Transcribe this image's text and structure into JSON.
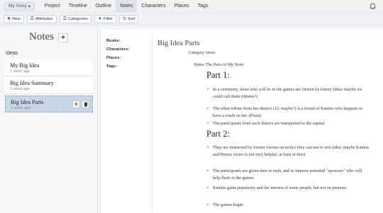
{
  "nav": {
    "story_label": "My Story",
    "links": [
      "Project",
      "Timeline",
      "Outline",
      "Notes",
      "Characters",
      "Places",
      "Tags"
    ],
    "active": "Notes"
  },
  "toolbar": {
    "new_label": "New",
    "attributes_label": "Attributes",
    "categories_label": "Categories",
    "filter_label": "Filter",
    "sort_label": "Sort"
  },
  "sidebar": {
    "title": "Notes",
    "add_label": "+",
    "group": "Ideas",
    "items": [
      {
        "title": "My Big Idea",
        "meta": "1 week ago"
      },
      {
        "title": "Big Idea Summary",
        "meta": "1 week ago"
      },
      {
        "title": "Big Idea Parts",
        "meta": "1 week ago"
      }
    ]
  },
  "main": {
    "props": [
      "Books:",
      "Characters:",
      "Places:",
      "Tags:"
    ],
    "title": "Big Idea Parts",
    "category_label": "Category",
    "category_value": "Ideas",
    "notes_label": "Notes",
    "notes_value": "The Parts of My Story",
    "part1_heading": "Part 1:",
    "part1": [
      "In a ceremony, those who will be in the games are chosen by lottery (idea: maybe we could call them tributes?)",
      "The other tribute from her district (12, maybe?) is a friend of Katniss who happens to have a crush on her. (Peeta)",
      "The participants from each district are transported to the capital."
    ],
    "part2_heading": "Part 2:",
    "part2": [
      "They are instructed by former victors on tactics they can use to win (idea: maybe Katniss and Peeta's victor is not very helpful, at least at first)",
      "The participants are given time to train, and to impress potential \"sponsors\" who will help them in the games.",
      "Katniss gains popularity and the interest of some people, but not on purpose.",
      "The games begin."
    ]
  }
}
